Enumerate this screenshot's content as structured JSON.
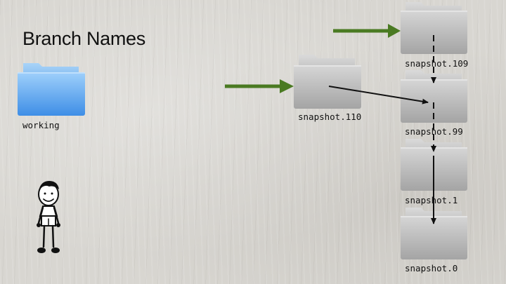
{
  "title": "Branch Names",
  "working_folder": {
    "label": "working",
    "color": "#4a90e2"
  },
  "branch_folder": {
    "label": "snapshot.110"
  },
  "snapshots": [
    {
      "label": "snapshot.109"
    },
    {
      "label": "snapshot.99"
    },
    {
      "label": "snapshot.1"
    },
    {
      "label": "snapshot.0"
    }
  ],
  "colors": {
    "branch_arrow": "#4a7a22",
    "snapshot_arrow": "#111111",
    "folder_gray": "#b4b4b4"
  },
  "figure": {
    "name": "stick-figure-person"
  }
}
